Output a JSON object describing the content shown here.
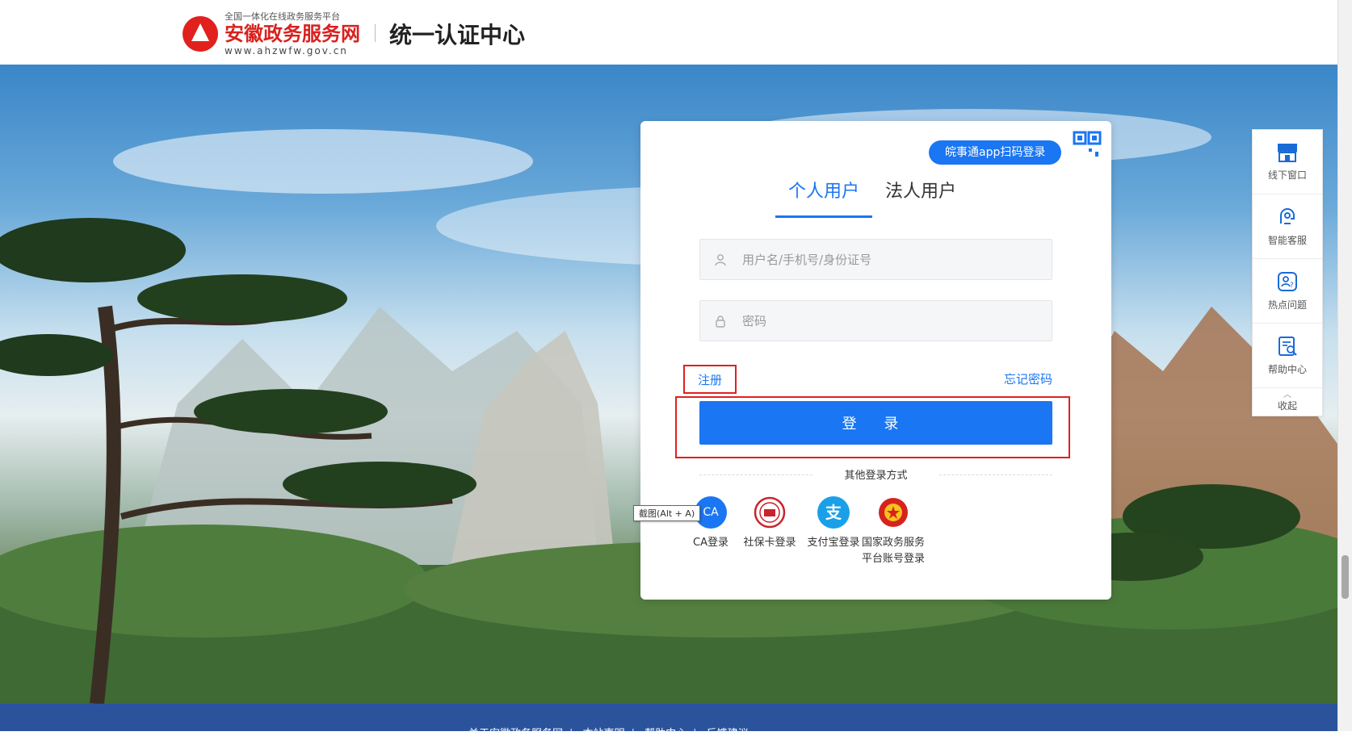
{
  "header": {
    "logo_small": "全国一体化在线政务服务平台",
    "logo_big": "安徽政务服务网",
    "logo_url": "www.ahzwfw.gov.cn",
    "title": "统一认证中心"
  },
  "login": {
    "qr_login_label": "皖事通app扫码登录",
    "tabs": [
      "个人用户",
      "法人用户"
    ],
    "active_tab": "个人用户",
    "username_placeholder": "用户名/手机号/身份证号",
    "password_placeholder": "密码",
    "register_label": "注册",
    "forgot_label": "忘记密码",
    "login_label": "登 录",
    "other_methods_title": "其他登录方式",
    "methods": [
      {
        "label": "CA登录",
        "icon": "ca-icon",
        "badge": "CA"
      },
      {
        "label": "社保卡登录",
        "icon": "social-security-card-icon"
      },
      {
        "label": "支付宝登录",
        "icon": "alipay-icon",
        "badge": "支"
      },
      {
        "label": "国家政务服务平台账号登录",
        "label_line1": "国家政务服务",
        "label_line2": "平台账号登录",
        "icon": "national-emblem-icon"
      }
    ],
    "tooltip": "截图(Alt + A)"
  },
  "float_panel": {
    "items": [
      {
        "label": "线下窗口",
        "icon": "store-icon"
      },
      {
        "label": "智能客服",
        "icon": "robot-icon"
      },
      {
        "label": "热点问题",
        "icon": "hot-question-icon"
      },
      {
        "label": "帮助中心",
        "icon": "help-doc-icon"
      }
    ],
    "collapse_label": "收起"
  },
  "footer": {
    "links": [
      "关于安徽政务服务网",
      "本站声明",
      "帮助中心",
      "反馈建议"
    ]
  },
  "colors": {
    "primary": "#1a76f2",
    "brand_red": "#d9211d",
    "highlight_red": "#e02020",
    "footer_bg": "#2b539c"
  }
}
